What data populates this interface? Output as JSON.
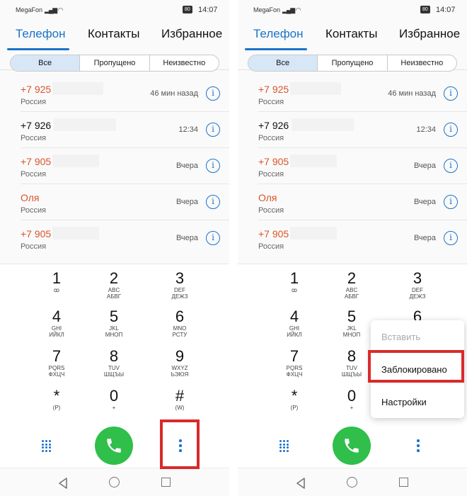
{
  "status_bar": {
    "carrier": "MegaFon",
    "battery": "80",
    "time": "14:07"
  },
  "tabs": [
    "Телефон",
    "Контакты",
    "Избранное"
  ],
  "filters": [
    "Все",
    "Пропущено",
    "Неизвестно"
  ],
  "calls": [
    {
      "number": "+7 925",
      "location": "Россия",
      "when": "46 мин назад",
      "missed": true
    },
    {
      "number": "+7 926",
      "location": "Россия",
      "when": "12:34",
      "missed": false
    },
    {
      "number": "+7 905",
      "location": "Россия",
      "when": "Вчера",
      "missed": true
    },
    {
      "number": "Оля",
      "location": "Россия",
      "when": "Вчера",
      "missed": true
    },
    {
      "number": "+7 905",
      "location": "Россия",
      "when": "Вчера",
      "missed": true
    }
  ],
  "keys": [
    {
      "digit": "1",
      "l1": "ꝏ",
      "l2": ""
    },
    {
      "digit": "2",
      "l1": "ABC",
      "l2": "АБВГ"
    },
    {
      "digit": "3",
      "l1": "DEF",
      "l2": "ДЕЖЗ"
    },
    {
      "digit": "4",
      "l1": "GHI",
      "l2": "ИЙКЛ"
    },
    {
      "digit": "5",
      "l1": "JKL",
      "l2": "МНОП"
    },
    {
      "digit": "6",
      "l1": "MNO",
      "l2": "РСТУ"
    },
    {
      "digit": "7",
      "l1": "PQRS",
      "l2": "ФХЦЧ"
    },
    {
      "digit": "8",
      "l1": "TUV",
      "l2": "ШЩЪЫ"
    },
    {
      "digit": "9",
      "l1": "WXYZ",
      "l2": "ЬЭЮЯ"
    },
    {
      "digit": "*",
      "l1": "(P)",
      "l2": ""
    },
    {
      "digit": "0",
      "l1": "+",
      "l2": ""
    },
    {
      "digit": "#",
      "l1": "(W)",
      "l2": ""
    }
  ],
  "menu": {
    "items": [
      "Вставить",
      "Заблокировано",
      "Настройки"
    ]
  },
  "colors": {
    "accent": "#1a73c9",
    "missed": "#d9542b",
    "call_green": "#2fbf4a",
    "highlight_red": "#d92a2a"
  },
  "icons": [
    "info-icon",
    "dialpad-grid-icon",
    "phone-icon",
    "more-vert-icon",
    "back-icon",
    "home-icon",
    "recents-icon"
  ]
}
